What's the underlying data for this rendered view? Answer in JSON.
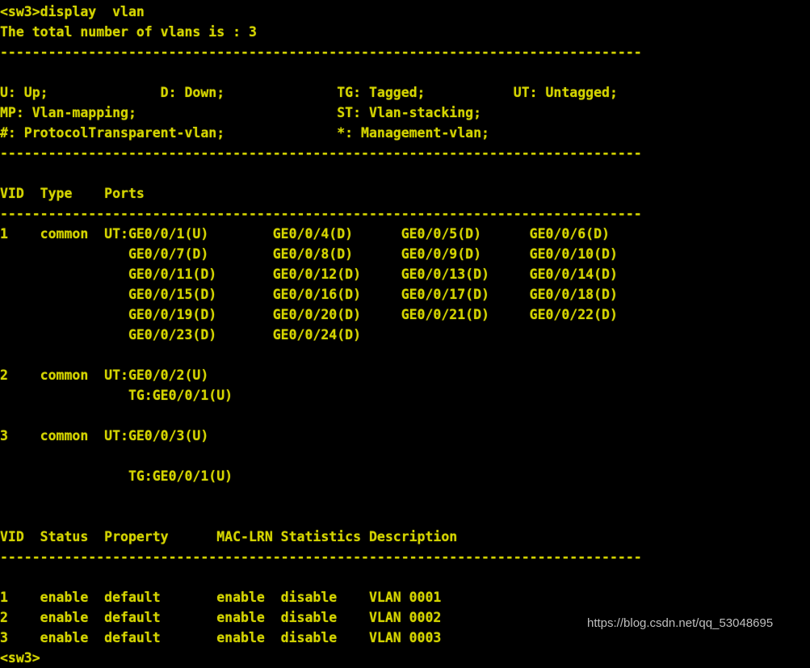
{
  "terminal": {
    "background_color": "#000000",
    "text_color": "#d4d400",
    "prompt": "<sw3>",
    "command": "display  vlan",
    "command_line": "<sw3>display  vlan",
    "summary_line": "The total number of vlans is : 3",
    "separator_top": "--------------------------------------------------------------------------------",
    "legend": [
      "U: Up;              D: Down;              TG: Tagged;           UT: Untagged;",
      "MP: Vlan-mapping;                         ST: Vlan-stacking;",
      "#: ProtocolTransparent-vlan;              *: Management-vlan;"
    ],
    "separator_legend": "--------------------------------------------------------------------------------",
    "ports_table": {
      "header": "VID  Type    Ports",
      "header_columns": [
        "VID",
        "Type",
        "Ports"
      ],
      "separator": "--------------------------------------------------------------------------------",
      "rows": [
        "1    common  UT:GE0/0/1(U)        GE0/0/4(D)      GE0/0/5(D)      GE0/0/6(D)",
        "                GE0/0/7(D)        GE0/0/8(D)      GE0/0/9(D)      GE0/0/10(D)",
        "                GE0/0/11(D)       GE0/0/12(D)     GE0/0/13(D)     GE0/0/14(D)",
        "                GE0/0/15(D)       GE0/0/16(D)     GE0/0/17(D)     GE0/0/18(D)",
        "                GE0/0/19(D)       GE0/0/20(D)     GE0/0/21(D)     GE0/0/22(D)",
        "                GE0/0/23(D)       GE0/0/24(D)",
        "",
        "2    common  UT:GE0/0/2(U)",
        "                TG:GE0/0/1(U)",
        "",
        "3    common  UT:GE0/0/3(U)",
        "",
        "                TG:GE0/0/1(U)"
      ],
      "vlans": [
        {
          "vid": "1",
          "type": "common",
          "untagged_ports": [
            "GE0/0/1(U)",
            "GE0/0/4(D)",
            "GE0/0/5(D)",
            "GE0/0/6(D)",
            "GE0/0/7(D)",
            "GE0/0/8(D)",
            "GE0/0/9(D)",
            "GE0/0/10(D)",
            "GE0/0/11(D)",
            "GE0/0/12(D)",
            "GE0/0/13(D)",
            "GE0/0/14(D)",
            "GE0/0/15(D)",
            "GE0/0/16(D)",
            "GE0/0/17(D)",
            "GE0/0/18(D)",
            "GE0/0/19(D)",
            "GE0/0/20(D)",
            "GE0/0/21(D)",
            "GE0/0/22(D)",
            "GE0/0/23(D)",
            "GE0/0/24(D)"
          ],
          "tagged_ports": []
        },
        {
          "vid": "2",
          "type": "common",
          "untagged_ports": [
            "GE0/0/2(U)"
          ],
          "tagged_ports": [
            "GE0/0/1(U)"
          ]
        },
        {
          "vid": "3",
          "type": "common",
          "untagged_ports": [
            "GE0/0/3(U)"
          ],
          "tagged_ports": [
            "GE0/0/1(U)"
          ]
        }
      ]
    },
    "status_table": {
      "header": "VID  Status  Property      MAC-LRN Statistics Description",
      "header_columns": [
        "VID",
        "Status",
        "Property",
        "MAC-LRN",
        "Statistics",
        "Description"
      ],
      "separator": "--------------------------------------------------------------------------------",
      "rows": [
        "1    enable  default       enable  disable    VLAN 0001",
        "2    enable  default       enable  disable    VLAN 0002",
        "3    enable  default       enable  disable    VLAN 0003"
      ],
      "records": [
        {
          "vid": "1",
          "status": "enable",
          "property": "default",
          "mac_lrn": "enable",
          "statistics": "disable",
          "description": "VLAN 0001"
        },
        {
          "vid": "2",
          "status": "enable",
          "property": "default",
          "mac_lrn": "enable",
          "statistics": "disable",
          "description": "VLAN 0002"
        },
        {
          "vid": "3",
          "status": "enable",
          "property": "default",
          "mac_lrn": "enable",
          "statistics": "disable",
          "description": "VLAN 0003"
        }
      ]
    },
    "final_prompt": "<sw3>"
  },
  "watermark": {
    "text": "https://blog.csdn.net/qq_53048695",
    "color": "#cfcfcf"
  }
}
